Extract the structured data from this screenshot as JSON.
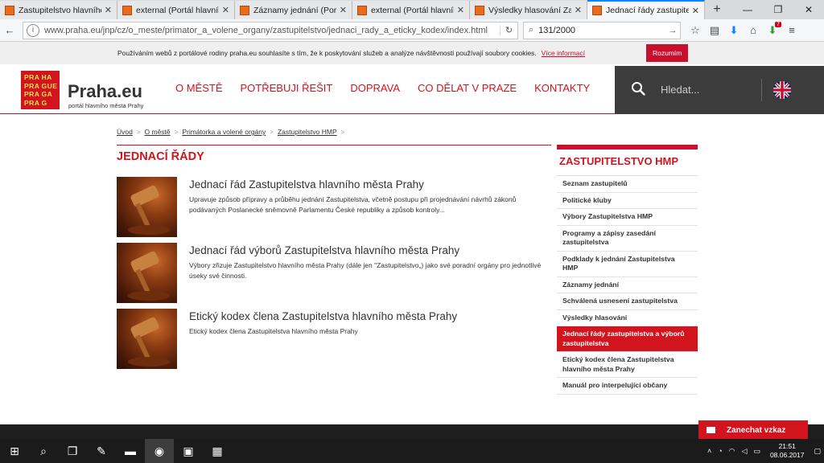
{
  "browser": {
    "tabs": [
      {
        "label": "Zastupitelstvo hlavního m",
        "active": false
      },
      {
        "label": "external (Portál hlavního",
        "active": false
      },
      {
        "label": "Záznamy jednání (Portál",
        "active": false
      },
      {
        "label": "external (Portál hlavního",
        "active": false
      },
      {
        "label": "Výsledky hlasování Zastu",
        "active": false
      },
      {
        "label": "Jednací řády zastupitelst",
        "active": true
      }
    ],
    "url": "www.praha.eu/jnp/cz/o_meste/primator_a_volene_organy/zastupitelstvo/jednaci_rady_a_eticky_kodex/index.html",
    "search_value": "131/2000",
    "extension_badge": "7"
  },
  "cookie": {
    "text": "Používáním webů z portálové rodiny praha.eu souhlasíte s tím, že k poskytování služeb a analýze návštěvnosti používají soubory cookies.",
    "link": "Více informací",
    "button": "Rozumím"
  },
  "header": {
    "logo_cells": [
      "PRA",
      "HA",
      "PRA",
      "GUE",
      "PRA",
      "GA",
      "PRA",
      "G"
    ],
    "site_name": "Praha.eu",
    "site_sub": "portál hlavního města Prahy",
    "nav": [
      "O MĚSTĚ",
      "POTŘEBUJI ŘEŠIT",
      "DOPRAVA",
      "CO DĚLAT V PRAZE",
      "KONTAKTY"
    ],
    "search_placeholder": "Hledat..."
  },
  "breadcrumb": [
    "Úvod",
    "O městě",
    "Primátorka a volené orgány",
    "Zastupitelstvo HMP"
  ],
  "page_title": "JEDNACÍ ŘÁDY",
  "articles": [
    {
      "title": "Jednací řád Zastupitelstva hlavního města Prahy",
      "desc": "Upravuje způsob přípravy a průběhu jednání Zastupitelstva, včetně postupu při projednávání návrhů zákonů podávaných Poslanecké sněmovně Parlamentu České republiky a způsob kontroly..."
    },
    {
      "title": "Jednací řád výborů Zastupitelstva hlavního města Prahy",
      "desc": "Výbory zřizuje Zastupitelstvo hlavního města Prahy (dále jen \"Zastupitelstvo„) jako své poradní orgány pro jednotlivé úseky své činnosti."
    },
    {
      "title": "Etický kodex člena Zastupitelstva hlavního města Prahy",
      "desc": "Etický kodex člena Zastupitelstva hlavního města Prahy"
    }
  ],
  "sidebar": {
    "title": "ZASTUPITELSTVO HMP",
    "items": [
      {
        "label": "Seznam zastupitelů",
        "active": false
      },
      {
        "label": "Politické kluby",
        "active": false
      },
      {
        "label": "Výbory Zastupitelstva HMP",
        "active": false
      },
      {
        "label": "Programy a zápisy zasedání zastupitelstva",
        "active": false
      },
      {
        "label": "Podklady k jednání Zastupitelstva HMP",
        "active": false
      },
      {
        "label": "Záznamy jednání",
        "active": false
      },
      {
        "label": "Schválená usnesení zastupitelstva",
        "active": false
      },
      {
        "label": "Výsledky hlasování",
        "active": false
      },
      {
        "label": "Jednací řády zastupitelstva a výborů zastupitelstva",
        "active": true
      },
      {
        "label": "Etický kodex člena Zastupitelstva hlavního města Prahy",
        "active": false
      },
      {
        "label": "Manuál pro interpelující občany",
        "active": false
      }
    ]
  },
  "feedback": "Zanechat vzkaz",
  "taskbar": {
    "time": "21:51",
    "date": "08.06.2017"
  },
  "colors": {
    "brand_red": "#d2141e",
    "dark_panel": "#3c3c3c",
    "logo_yellow": "#fbe24e"
  }
}
